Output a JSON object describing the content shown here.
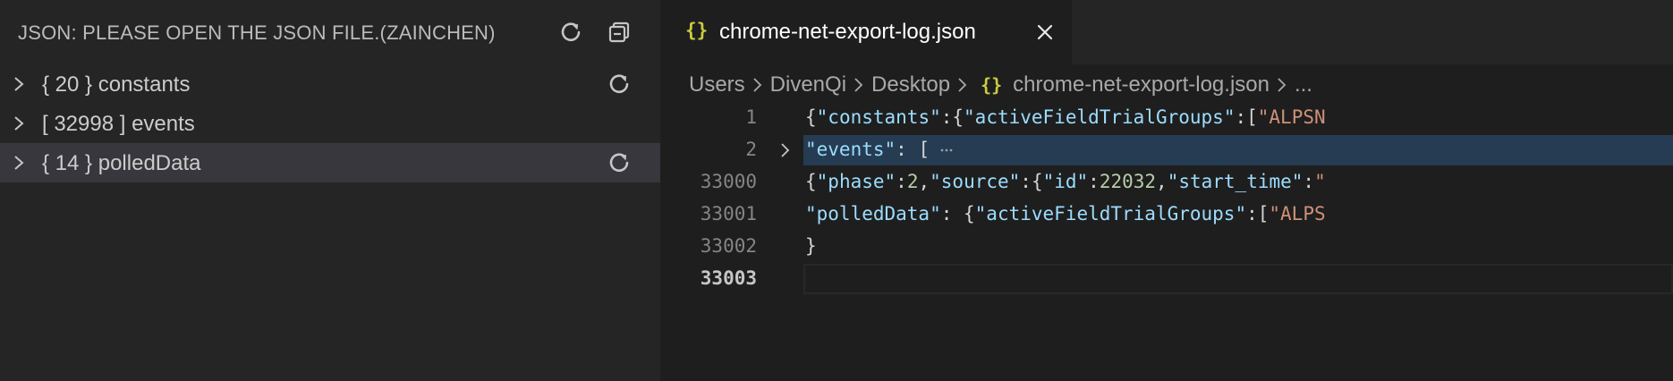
{
  "sidebar": {
    "title": "JSON: PLEASE OPEN THE JSON FILE.(ZAINCHEN)",
    "items": [
      {
        "label": "{ 20 } constants",
        "has_refresh": true
      },
      {
        "label": "[ 32998 ] events",
        "has_refresh": false
      },
      {
        "label": "{ 14 } polledData",
        "has_refresh": true,
        "selected": true
      }
    ]
  },
  "tab": {
    "icon": "{}",
    "title": "chrome-net-export-log.json",
    "close": "×"
  },
  "breadcrumb": {
    "parts": [
      "Users",
      "DivenQi",
      "Desktop"
    ],
    "file_icon": "{}",
    "file": "chrome-net-export-log.json",
    "more": "..."
  },
  "editor": {
    "lines": [
      {
        "num": "1"
      },
      {
        "num": "2"
      },
      {
        "num": "33000"
      },
      {
        "num": "33001"
      },
      {
        "num": "33002"
      },
      {
        "num": "33003"
      }
    ],
    "l1": {
      "a": "{",
      "k1": "\"constants\"",
      "b": ":{",
      "k2": "\"activeFieldTrialGroups\"",
      "c": ":[",
      "s1": "\"ALPSN"
    },
    "l2": {
      "k": "\"events\"",
      "b": ": ["
    },
    "l3": {
      "a": "{",
      "k1": "\"phase\"",
      "b": ":",
      "n1": "2",
      "c": ",",
      "k2": "\"source\"",
      "d": ":{",
      "k3": "\"id\"",
      "e": ":",
      "n2": "22032",
      "f": ",",
      "k4": "\"start_time\"",
      "g": ":",
      "s1": "\""
    },
    "l4": {
      "k": "\"polledData\"",
      "b": ": {",
      "k2": "\"activeFieldTrialGroups\"",
      "c": ":[",
      "s1": "\"ALPS"
    },
    "l5": {
      "a": "}"
    }
  },
  "colors": {
    "sidebar_bg": "#252526",
    "editor_bg": "#1e1e1e",
    "selected_row": "#37373d",
    "json_icon": "#cbcb41",
    "key": "#9cdcfe",
    "string": "#ce9178",
    "number": "#b5cea8"
  },
  "icons": {
    "refresh": "refresh-icon",
    "collapse_all": "collapse-all-icon",
    "chevron": "chevron-right-icon",
    "close": "close-icon"
  }
}
